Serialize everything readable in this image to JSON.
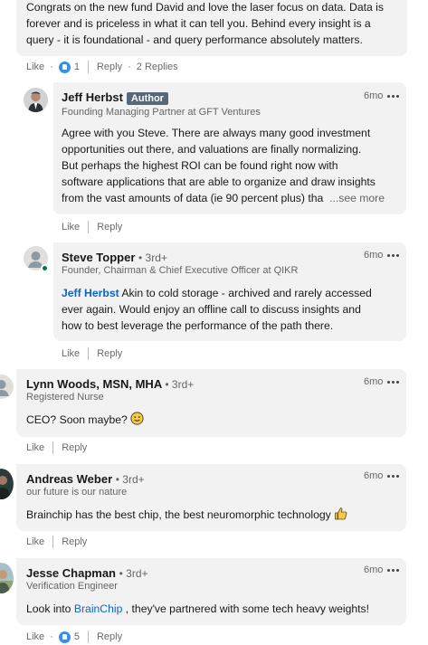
{
  "top_comment": {
    "text_lines": [
      "Congrats on the new fund David and love the laser focus on data. Data is",
      "forever and is priceless in what it can tell you. Behind every insight is a",
      "query - it is foundational - and query performance absolutely matters."
    ],
    "like_label": "Like",
    "like_count": "1",
    "reply_label": "Reply",
    "replies_label": "2 Replies"
  },
  "replies": [
    {
      "name": "Jeff Herbst",
      "badge": "Author",
      "headline": "Founding Managing Partner at GFT Ventures",
      "time": "6mo",
      "text_lines": [
        "Agree with you Steve. There are always many good investment",
        "opportunities out there, and valuations are finally normalizing.",
        "But perhaps the highest ROI can be found right now with",
        "software applications that are able to organize and draw insights",
        "from the vast amounts of data (ie 90 percent plus) tha"
      ],
      "see_more": "...see more",
      "like_label": "Like",
      "reply_label": "Reply"
    },
    {
      "name": "Steve Topper",
      "degree": "• 3rd+",
      "headline": "Founder, Chairman & Chief Executive Officer at QIKR",
      "time": "6mo",
      "mention": "Jeff Herbst",
      "text_first": " Akin to cold storage - archived and rarely accessed",
      "text_lines": [
        "ever again. Would enjoy an offline call to discuss insights and",
        "how to best leverage the performance of the path there."
      ],
      "like_label": "Like",
      "reply_label": "Reply"
    }
  ],
  "comments": [
    {
      "name": "Lynn Woods, MSN, MHA",
      "degree": "• 3rd+",
      "headline": "Registered Nurse",
      "time": "6mo",
      "text": "CEO? Soon maybe? ",
      "emoji_icon": "smiley-face-icon",
      "like_label": "Like",
      "reply_label": "Reply"
    },
    {
      "name": "Andreas Weber",
      "degree": "• 3rd+",
      "headline": "our future is our nature",
      "time": "6mo",
      "text": "Brainchip has the best chip, the best neuromorphic technology ",
      "emoji_icon": "thumbs-up-emoji-icon",
      "like_label": "Like",
      "reply_label": "Reply"
    },
    {
      "name": "Jesse Chapman",
      "degree": "• 3rd+",
      "headline": "Verification Engineer",
      "time": "6mo",
      "link": "BrainChip",
      "text_before": "Look into ",
      "text_after": " , they've partnered with some tech heavy weights!",
      "like_label": "Like",
      "like_count": "5",
      "reply_label": "Reply"
    }
  ],
  "colors": {
    "link": "#0a66c2",
    "bubble": "#f2f2f2",
    "like_badge": "#378fe9",
    "online": "#057642"
  }
}
